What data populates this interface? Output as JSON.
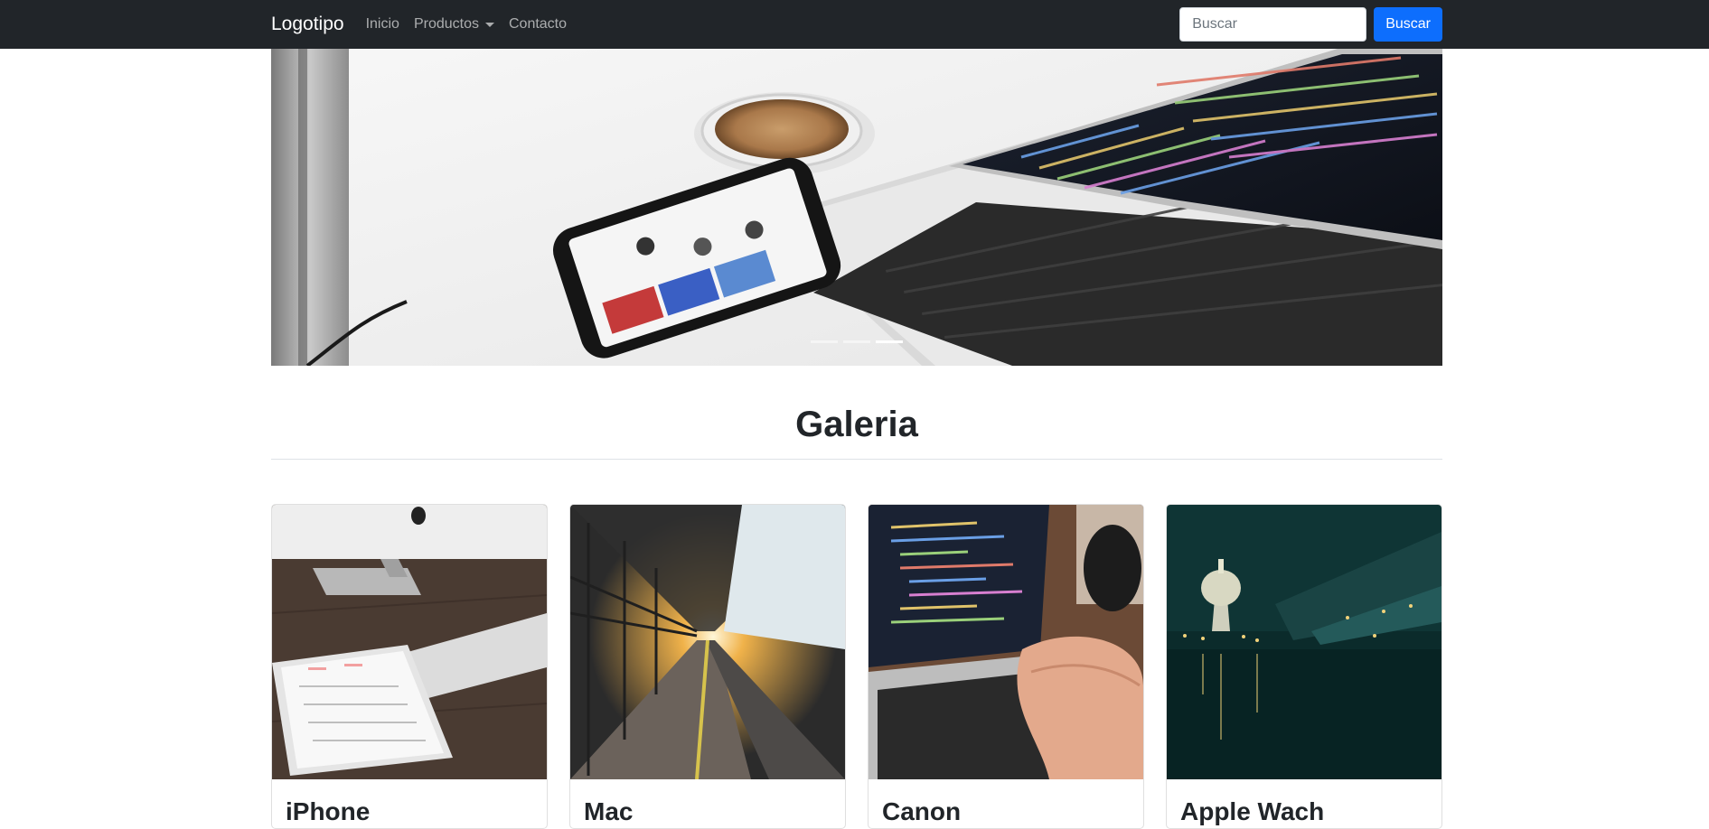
{
  "navbar": {
    "brand": "Logotipo",
    "links": [
      {
        "label": "Inicio"
      },
      {
        "label": "Productos"
      },
      {
        "label": "Contacto"
      }
    ],
    "search": {
      "placeholder": "Buscar",
      "button_label": "Buscar"
    },
    "colors": {
      "background": "#212529",
      "button": "#0d6efd"
    }
  },
  "carousel": {
    "slide_count": 3,
    "active_slide": 3
  },
  "gallery": {
    "title": "Galeria",
    "cards": [
      {
        "title": "iPhone",
        "image": "desk-with-imac-and-calendar-tablet"
      },
      {
        "title": "Mac",
        "image": "train-station-platform-at-sunset"
      },
      {
        "title": "Canon",
        "image": "laptop-with-code-and-hands-typing"
      },
      {
        "title": "Apple Wach",
        "image": "city-skyline-at-night-with-dome"
      }
    ]
  }
}
